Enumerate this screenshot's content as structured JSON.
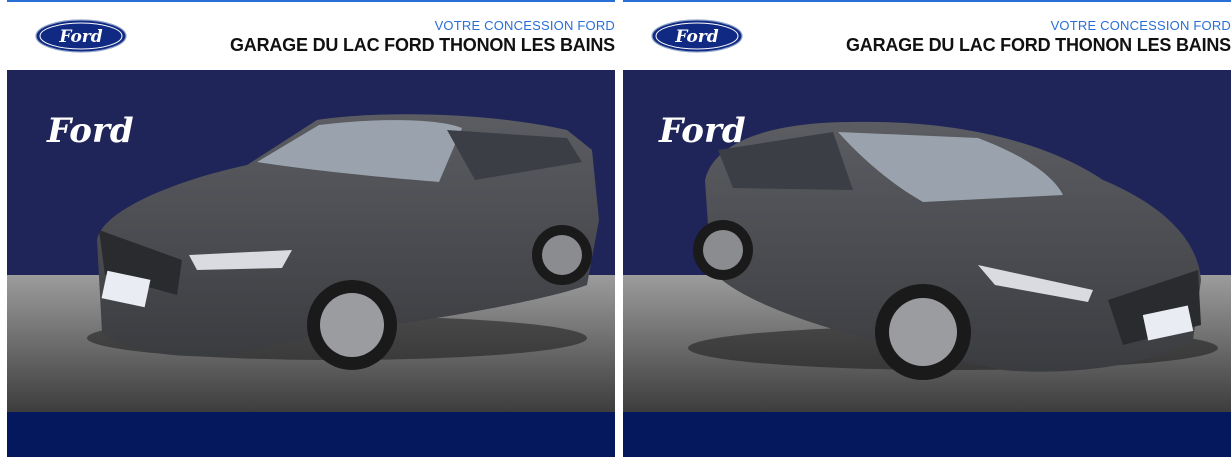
{
  "listing": {
    "cards": [
      {
        "dealer_subtitle": "VOTRE CONCESSION FORD",
        "dealer_name": "GARAGE DU LAC FORD THONON LES BAINS",
        "view": "front-three-quarter-left"
      },
      {
        "dealer_subtitle": "VOTRE CONCESSION FORD",
        "dealer_name": "GARAGE DU LAC FORD THONON LES BAINS",
        "view": "front-three-quarter-right"
      }
    ]
  },
  "brand": {
    "logo_text": "Ford",
    "colors": {
      "ford_blue": "#1f2559",
      "oval_blue": "#102a83",
      "accent_blue": "#2a6fd6",
      "footer_navy": "#06185d",
      "car_paint": "#4a4c50"
    }
  },
  "icons": {
    "logo": "ford-oval-logo-icon",
    "backdrop_logo": "ford-script-logo-icon"
  }
}
